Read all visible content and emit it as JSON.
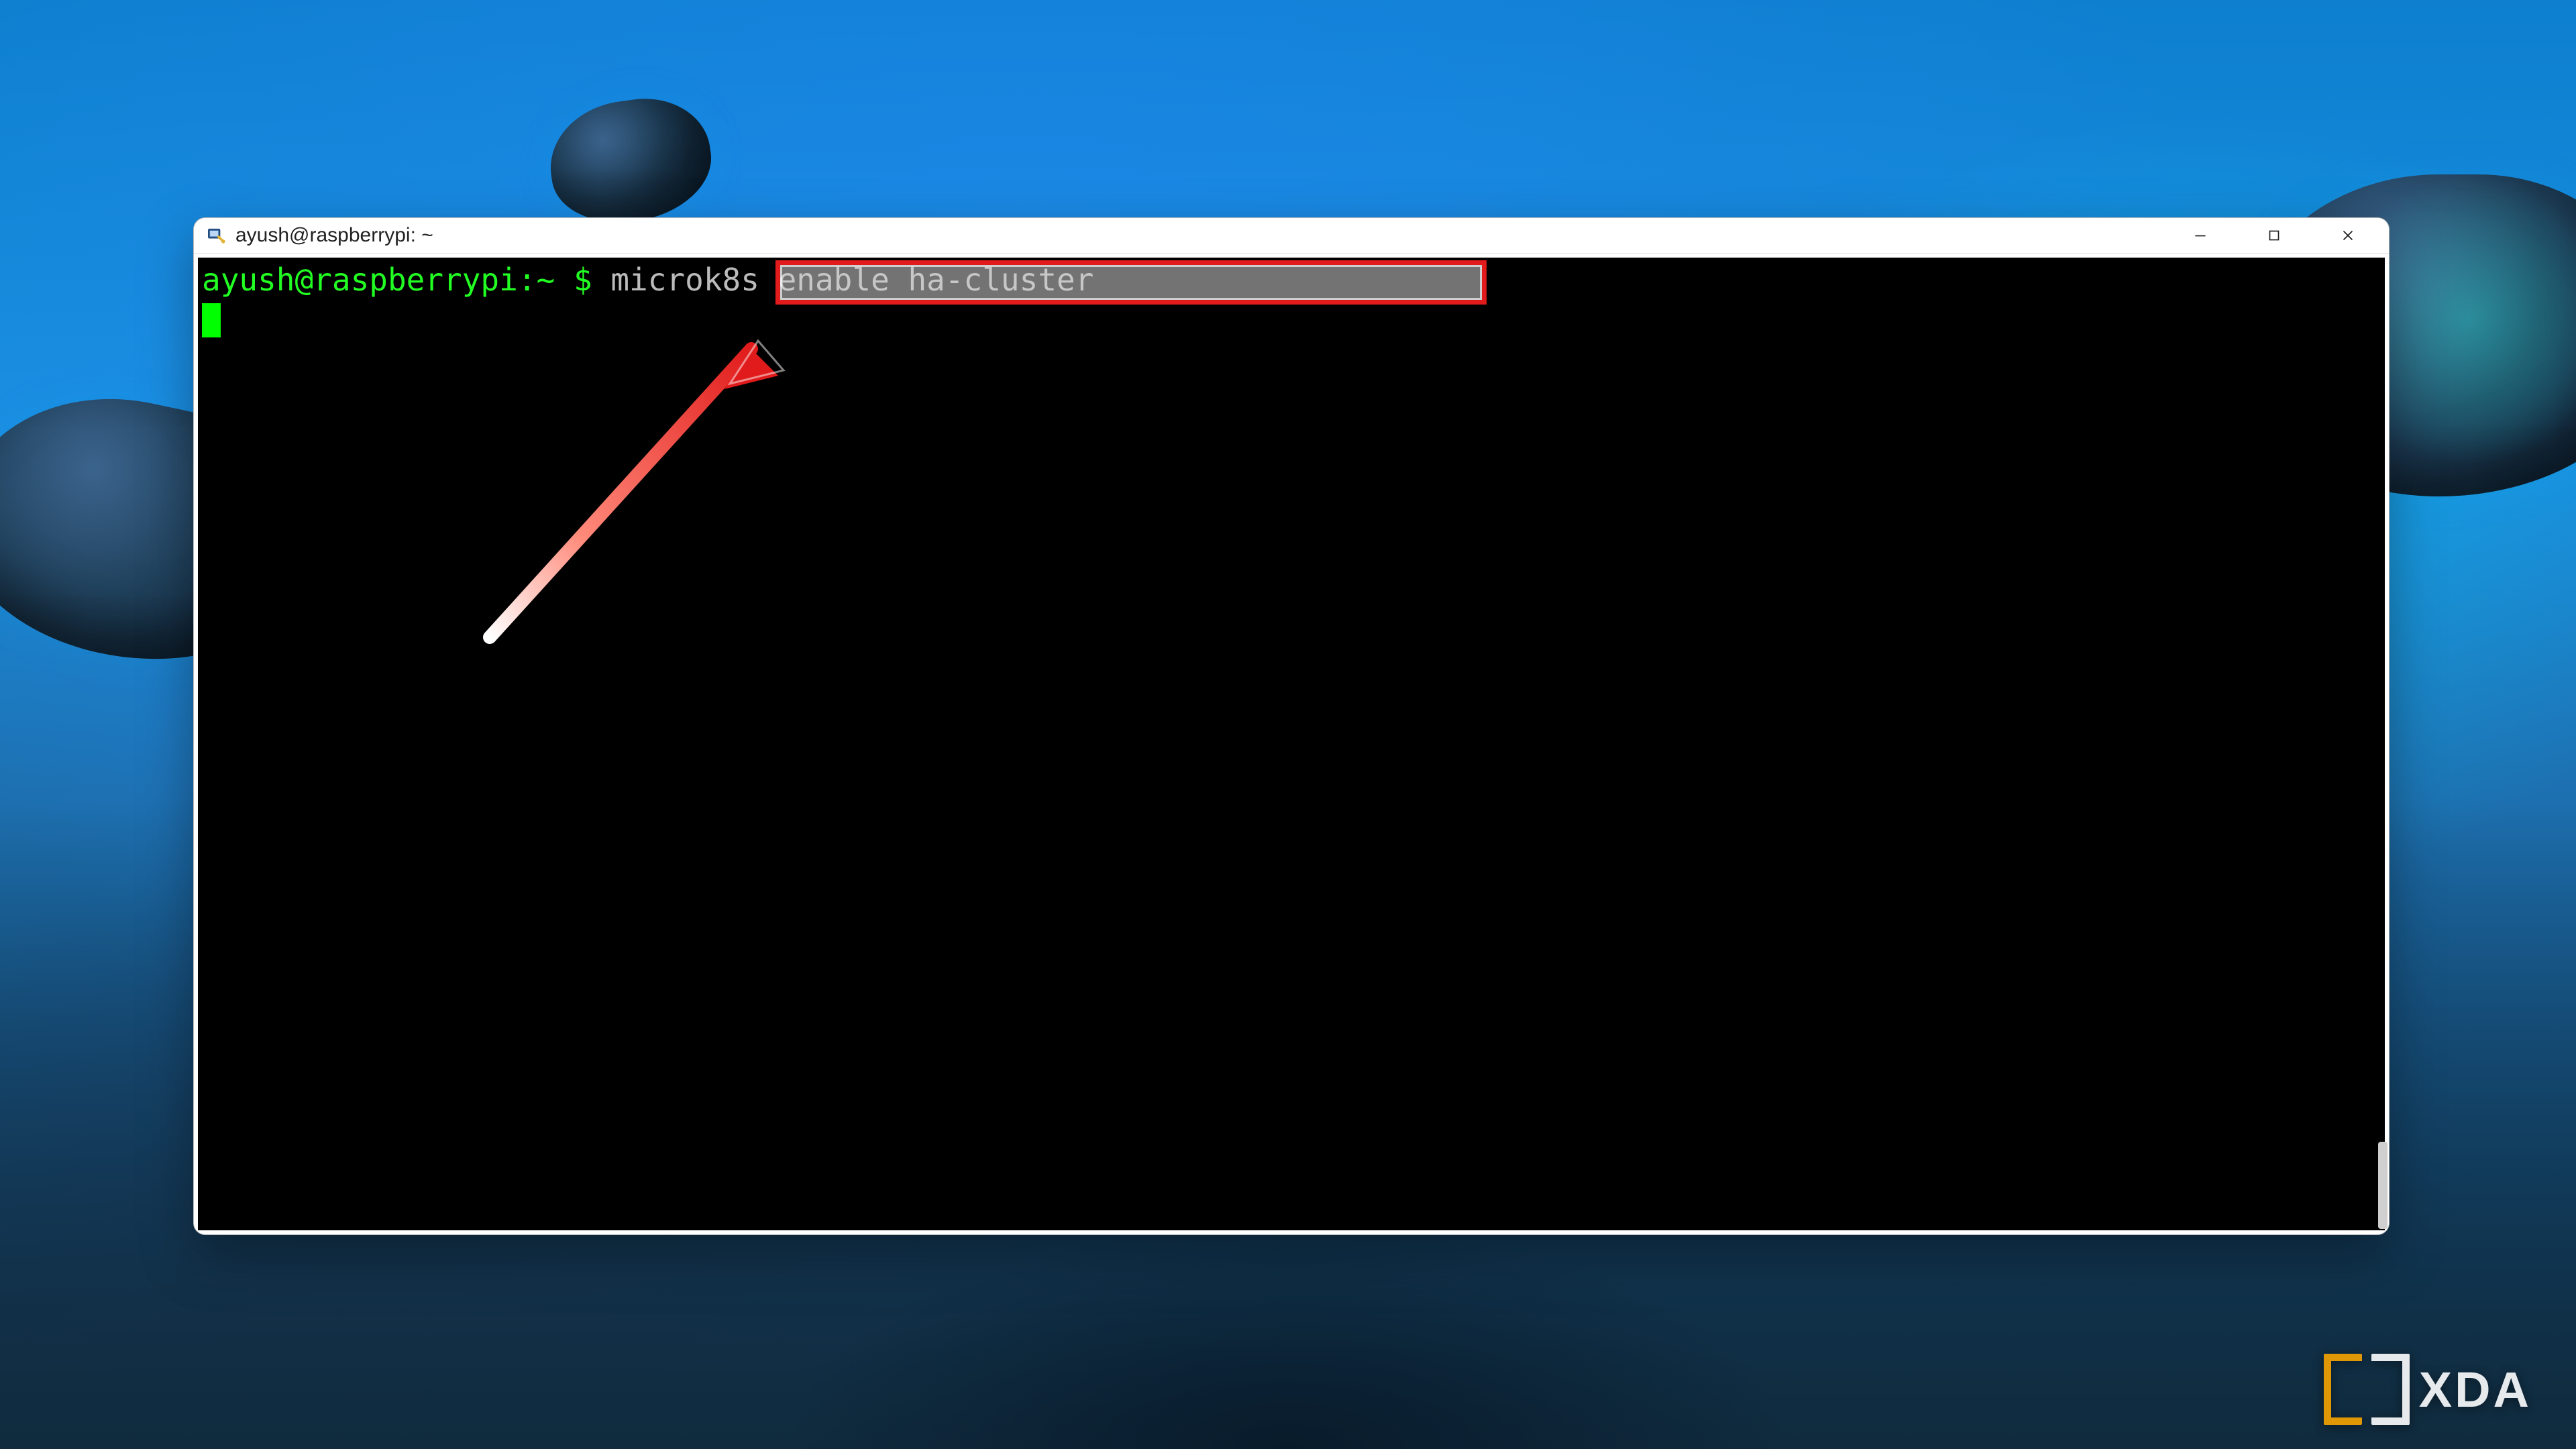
{
  "window": {
    "title": "ayush@raspberrypi: ~",
    "app_icon": "putty-icon"
  },
  "terminal": {
    "prompt": {
      "user": "ayush",
      "at": "@",
      "host": "raspberrypi",
      "sep": ":",
      "path": "~",
      "symbol": "$"
    },
    "command": "microk8s enable ha-cluster"
  },
  "branding": {
    "xda": "XDA"
  },
  "annotation": {
    "target": "command",
    "kind": "highlight-arrow"
  }
}
